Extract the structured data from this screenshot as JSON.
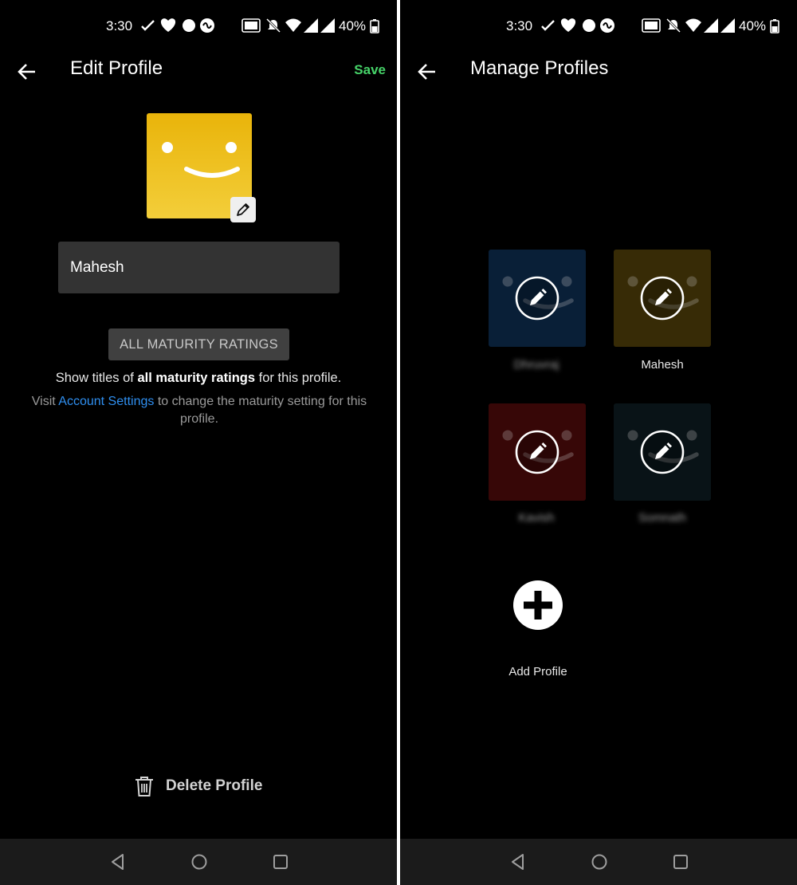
{
  "status_bar": {
    "time": "3:30",
    "battery": "40%"
  },
  "edit_profile": {
    "title": "Edit Profile",
    "save_label": "Save",
    "name_value": "Mahesh",
    "maturity_button": "ALL MATURITY RATINGS",
    "maturity_desc_pre": "Show titles of ",
    "maturity_desc_bold": "all maturity ratings",
    "maturity_desc_post": " for this profile.",
    "visit_pre": "Visit ",
    "visit_link": "Account Settings",
    "visit_post": " to change the maturity setting for this profile.",
    "delete_label": "Delete Profile",
    "avatar_color": "#e9b40a"
  },
  "manage_profiles": {
    "title": "Manage Profiles",
    "profiles": [
      {
        "name": "Dhruvraj",
        "color": "#0d2a4a",
        "blurred": true
      },
      {
        "name": "Mahesh",
        "color": "#4a3a08",
        "blurred": false
      },
      {
        "name": "Kavish",
        "color": "#4a0a0a",
        "blurred": true
      },
      {
        "name": "Somnath",
        "color": "#0d1a1f",
        "blurred": true
      }
    ],
    "add_label": "Add Profile"
  },
  "icons": [
    "back-arrow-icon",
    "pencil-icon",
    "trash-icon",
    "plus-circle-icon",
    "nav-back-icon",
    "nav-home-icon",
    "nav-recents-icon",
    "wifi-icon",
    "signal-icon",
    "battery-icon",
    "mute-icon",
    "heart-icon"
  ],
  "colors": {
    "save_green": "#46d369",
    "link_blue": "#2f8ff0",
    "input_bg": "#333333"
  }
}
